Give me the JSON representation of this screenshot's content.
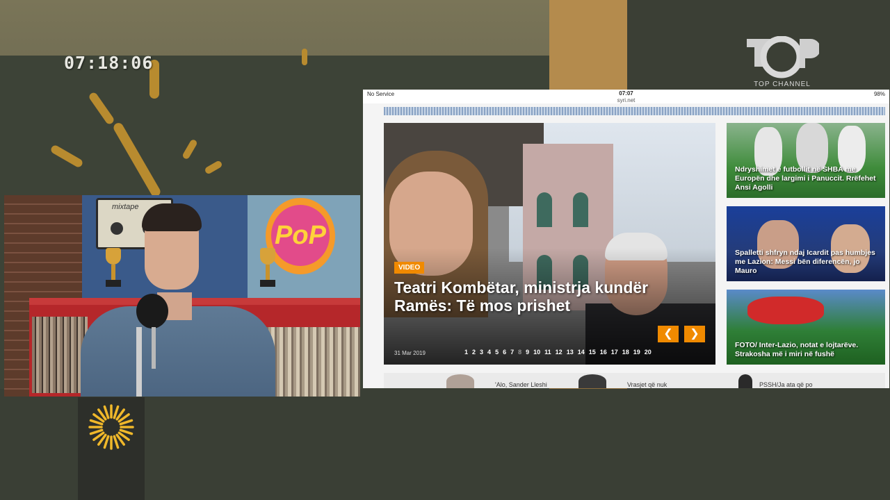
{
  "overlay": {
    "clock": "07:18:06",
    "channel_logo_text": "TOP CHANNEL"
  },
  "studio": {
    "mixtape_label": "mixtape",
    "pop_sign": "PoP"
  },
  "tablet": {
    "status": {
      "carrier": "No Service",
      "time": "07:07",
      "url": "syri.net",
      "battery": "98%"
    },
    "hero": {
      "badge": "VIDEO",
      "headline": "Teatri Kombëtar, ministrja kundër Ramës: Të mos prishet",
      "date": "31 Mar 2019",
      "prev_icon": "chevron-left-icon",
      "next_icon": "chevron-right-icon",
      "pages": [
        "1",
        "2",
        "3",
        "4",
        "5",
        "6",
        "7",
        "8",
        "9",
        "10",
        "11",
        "12",
        "13",
        "14",
        "15",
        "16",
        "17",
        "18",
        "19",
        "20"
      ],
      "active_page": "8"
    },
    "side_articles": [
      {
        "title": "Ndryshimet e futbollit në SHBA me Europën dhe largimi i Panuccit. Rrëfehet Ansi Agolli"
      },
      {
        "title": "Spalletti shfryn ndaj Icardit pas humbjes me Lazion: Messi bën diferencën, jo Mauro"
      },
      {
        "title": "FOTO/ Inter-Lazio, notat e lojtarëve. Strakosha më i miri në fushë"
      }
    ],
    "bottom_articles": [
      {
        "title": "'Alo, Sander Lleshi"
      },
      {
        "title": "Vrasjet që nuk"
      },
      {
        "title": "PSSH/Ja ata që po"
      }
    ]
  }
}
